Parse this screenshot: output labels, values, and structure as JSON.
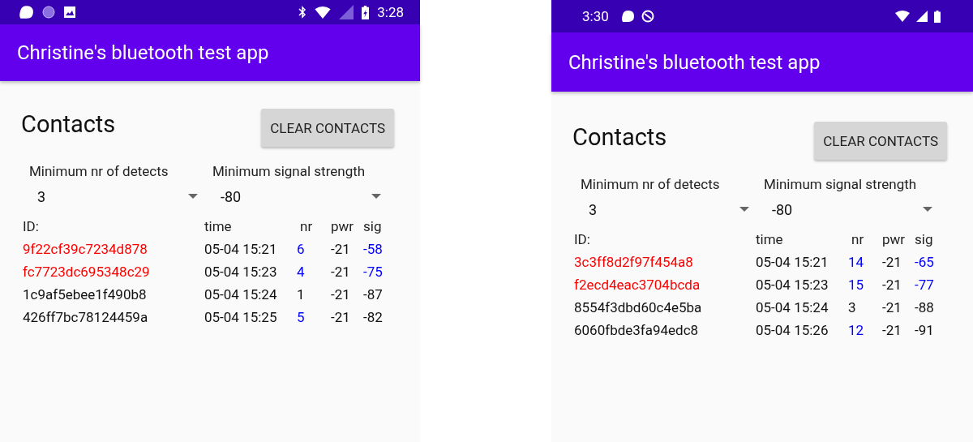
{
  "phones": [
    {
      "status_bar": {
        "kind": "time_right",
        "time": "3:28"
      },
      "app_bar": {
        "title": "Christine's bluetooth test app"
      },
      "contacts": {
        "title": "Contacts",
        "clear_button": "CLEAR CONTACTS",
        "filters": [
          {
            "label": "Minimum nr of detects",
            "value": "3"
          },
          {
            "label": "Minimum signal strength",
            "value": "-80"
          }
        ],
        "columns": [
          "ID:",
          "time",
          "nr",
          "pwr",
          "sig"
        ],
        "rows": [
          {
            "id": "9f22cf39c7234d878",
            "id_alert": true,
            "time": "05-04 15:21",
            "nr": "6",
            "nr_alert": true,
            "pwr": "-21",
            "sig": "-58",
            "sig_alert": true
          },
          {
            "id": "fc7723dc695348c29",
            "id_alert": true,
            "time": "05-04 15:23",
            "nr": "4",
            "nr_alert": true,
            "pwr": "-21",
            "sig": "-75",
            "sig_alert": true
          },
          {
            "id": "1c9af5ebee1f490b8",
            "id_alert": false,
            "time": "05-04 15:24",
            "nr": "1",
            "nr_alert": false,
            "pwr": "-21",
            "sig": "-87",
            "sig_alert": false
          },
          {
            "id": "426ff7bc78124459a",
            "id_alert": false,
            "time": "05-04 15:25",
            "nr": "5",
            "nr_alert": true,
            "pwr": "-21",
            "sig": "-82",
            "sig_alert": false
          }
        ]
      }
    },
    {
      "status_bar": {
        "kind": "time_left",
        "time": "3:30"
      },
      "app_bar": {
        "title": "Christine's bluetooth test app"
      },
      "contacts": {
        "title": "Contacts",
        "clear_button": "CLEAR CONTACTS",
        "filters": [
          {
            "label": "Minimum nr of detects",
            "value": "3"
          },
          {
            "label": "Minimum signal strength",
            "value": "-80"
          }
        ],
        "columns": [
          "ID:",
          "time",
          "nr",
          "pwr",
          "sig"
        ],
        "rows": [
          {
            "id": "3c3ff8d2f97f454a8",
            "id_alert": true,
            "time": "05-04 15:21",
            "nr": "14",
            "nr_alert": true,
            "pwr": "-21",
            "sig": "-65",
            "sig_alert": true
          },
          {
            "id": "f2ecd4eac3704bcda",
            "id_alert": true,
            "time": "05-04 15:23",
            "nr": "15",
            "nr_alert": true,
            "pwr": "-21",
            "sig": "-77",
            "sig_alert": true
          },
          {
            "id": "8554f3dbd60c4e5ba",
            "id_alert": false,
            "time": "05-04 15:24",
            "nr": "3",
            "nr_alert": false,
            "pwr": "-21",
            "sig": "-88",
            "sig_alert": false
          },
          {
            "id": "6060fbde3fa94edc8",
            "id_alert": false,
            "time": "05-04 15:26",
            "nr": "12",
            "nr_alert": true,
            "pwr": "-21",
            "sig": "-91",
            "sig_alert": false
          }
        ]
      }
    }
  ]
}
